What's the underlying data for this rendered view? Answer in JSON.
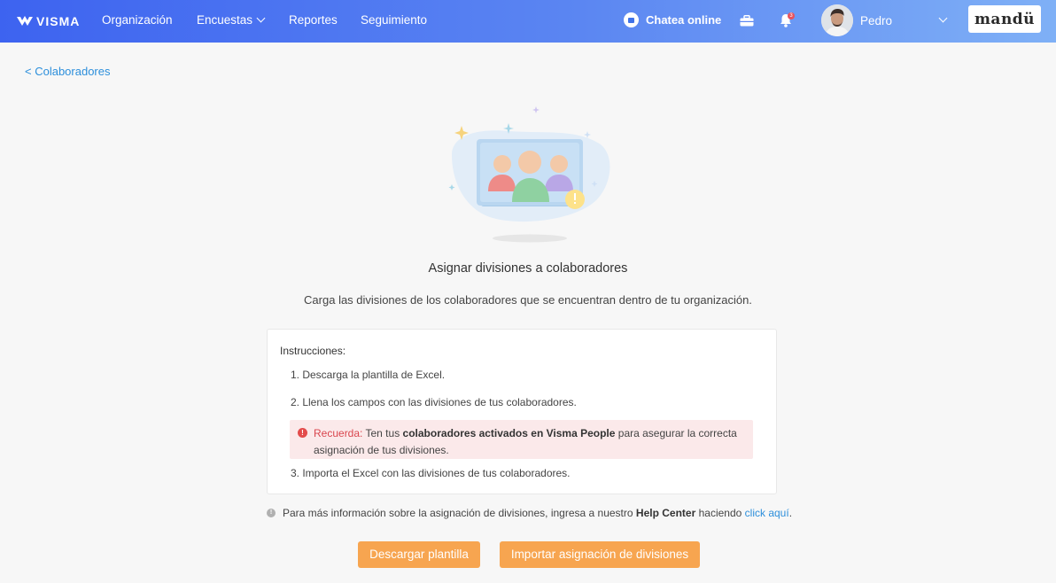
{
  "topbar": {
    "logo_text": "VISMA",
    "nav": [
      {
        "label": "Organización"
      },
      {
        "label": "Encuestas"
      },
      {
        "label": "Reportes"
      },
      {
        "label": "Seguimiento"
      }
    ],
    "chat_label": "Chatea online",
    "notifications_count": "3",
    "user_name": "Pedro",
    "brand": "mandü",
    "colors": {
      "gradient_start": "#3d63f0",
      "gradient_end": "#7fb0f6"
    }
  },
  "back_link": "< Colaboradores",
  "main": {
    "title": "Asignar divisiones a colaboradores",
    "subtitle": "Carga las divisiones de los colaboradores que se encuentran dentro de tu organización."
  },
  "instructions": {
    "heading": "Instrucciones:",
    "steps": [
      "1. Descarga la plantilla de Excel.",
      "2. Llena los campos con las divisiones de tus colaboradores.",
      "3. Importa el Excel con las divisiones de tus colaboradores."
    ],
    "reminder": {
      "label": "Recuerda:",
      "text_before": "Ten tus",
      "bold_text": "colaboradores activados en Visma People",
      "text_after": "para asegurar la correcta asignación de tus divisiones."
    }
  },
  "info": {
    "text_before": "Para más información sobre la asignación de divisiones, ingresa a nuestro",
    "bold_text": "Help Center",
    "text_middle": "haciendo",
    "link_text": "click aquí",
    "text_end": "."
  },
  "buttons": {
    "download": "Descargar plantilla",
    "import": "Importar asignación de divisiones",
    "color": "#f7a550"
  }
}
